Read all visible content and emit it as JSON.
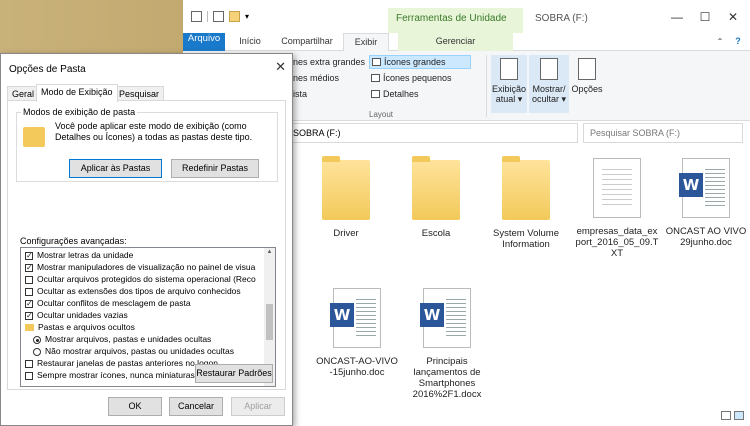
{
  "explorer": {
    "context_tab": "Ferramentas de Unidade",
    "window_title": "SOBRA (F:)",
    "window_controls": [
      "—",
      "☐",
      "✕"
    ],
    "tabs": [
      "Arquivo",
      "Início",
      "Compartilhar",
      "Exibir",
      "Gerenciar"
    ],
    "ribbon": {
      "layout_items": [
        "ones extra grandes",
        "Ícones grandes",
        "ones médios",
        "Ícones pequenos",
        "Lista",
        "Detalhes"
      ],
      "layout_group": "Layout",
      "big_buttons": [
        "Exibição atual ▾",
        "Mostrar/ ocultar ▾",
        "Opções"
      ]
    },
    "address": "SOBRA (F:)",
    "search_placeholder": "Pesquisar SOBRA (F:)",
    "files": [
      {
        "name": "Driver",
        "type": "folder"
      },
      {
        "name": "Escola",
        "type": "folder"
      },
      {
        "name": "System Volume Information",
        "type": "folder"
      },
      {
        "name": "empresas_data_export_2016_05_09.TXT",
        "type": "txt"
      },
      {
        "name": "ONCAST AO VIVO 29junho.doc",
        "type": "doc"
      },
      {
        "name": "ONCAST-AO-VIVO-15junho.doc",
        "type": "doc"
      },
      {
        "name": "Principais lançamentos de Smartphones 2016%2F1.docx",
        "type": "doc"
      }
    ]
  },
  "dialog": {
    "title": "Opções de Pasta",
    "tabs": [
      "Geral",
      "Modo de Exibição",
      "Pesquisar"
    ],
    "folder_views": {
      "legend": "Modos de exibição de pasta",
      "text": "Você pode aplicar este modo de exibição (como Detalhes ou Ícones) a todas as pastas deste tipo.",
      "apply_button": "Aplicar às Pastas",
      "reset_button": "Redefinir Pastas"
    },
    "advanced_label": "Configurações avançadas:",
    "advanced_items": [
      {
        "label": "Mostrar letras da unidade",
        "kind": "checkbox",
        "checked": true
      },
      {
        "label": "Mostrar manipuladores de visualização no painel de visua",
        "kind": "checkbox",
        "checked": true
      },
      {
        "label": "Ocultar arquivos protegidos do sistema operacional (Reco",
        "kind": "checkbox",
        "checked": false
      },
      {
        "label": "Ocultar as extensões dos tipos de arquivo conhecidos",
        "kind": "checkbox",
        "checked": false
      },
      {
        "label": "Ocultar conflitos de mesclagem de pasta",
        "kind": "checkbox",
        "checked": true
      },
      {
        "label": "Ocultar unidades vazias",
        "kind": "checkbox",
        "checked": true
      },
      {
        "label": "Pastas e arquivos ocultos",
        "kind": "folder",
        "checked": false
      },
      {
        "label": "Mostrar arquivos, pastas e unidades ocultas",
        "kind": "radio",
        "checked": true
      },
      {
        "label": "Não mostrar arquivos, pastas ou unidades ocultas",
        "kind": "radio",
        "checked": false
      },
      {
        "label": "Restaurar janelas de pastas anteriores no logon",
        "kind": "checkbox",
        "checked": false
      },
      {
        "label": "Sempre mostrar ícones, nunca miniaturas",
        "kind": "checkbox",
        "checked": false
      }
    ],
    "restore_button": "Restaurar Padrões",
    "ok_button": "OK",
    "cancel_button": "Cancelar",
    "apply_button": "Aplicar"
  }
}
